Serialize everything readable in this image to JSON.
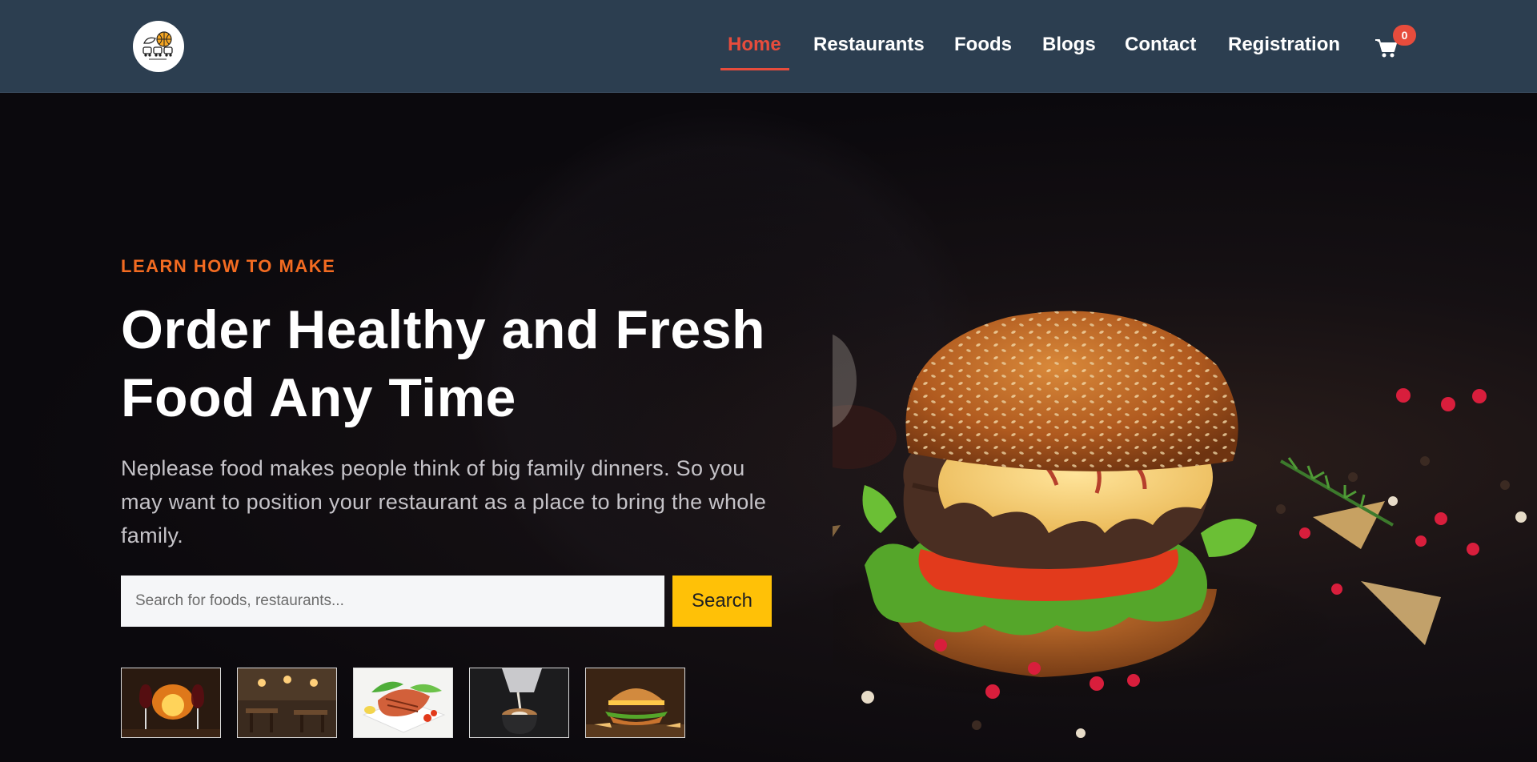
{
  "header": {
    "nav": [
      {
        "label": "Home",
        "active": true
      },
      {
        "label": "Restaurants"
      },
      {
        "label": "Foods"
      },
      {
        "label": "Blogs"
      },
      {
        "label": "Contact"
      },
      {
        "label": "Registration"
      }
    ],
    "cart_count": "0",
    "accent_color": "#e74c3c",
    "background_color": "#2c3e50"
  },
  "hero": {
    "eyebrow": "LEARN HOW TO MAKE",
    "title_line1": "Order Healthy and Fresh",
    "title_line2": "Food Any Time",
    "subtitle": "Neplease food makes people think of big family dinners. So you may want to position your restaurant as a place to bring the whole family.",
    "search_placeholder": "Search for foods, restaurants...",
    "search_value": "",
    "search_button": "Search",
    "eyebrow_color": "#f36b21",
    "button_color": "#ffc107",
    "thumbnails": [
      {
        "icon": "wine-fireplace-image"
      },
      {
        "icon": "restaurant-interior-image"
      },
      {
        "icon": "grilled-salmon-image"
      },
      {
        "icon": "latte-pour-image"
      },
      {
        "icon": "burger-image"
      }
    ]
  }
}
